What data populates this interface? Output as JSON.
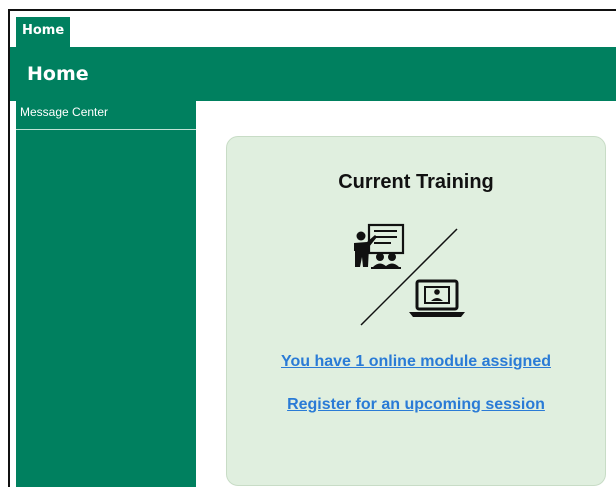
{
  "tabs": [
    {
      "label": "Home"
    }
  ],
  "header": {
    "title": "Home"
  },
  "sidebar": {
    "items": [
      {
        "label": "Message Center"
      }
    ]
  },
  "card": {
    "title": "Current Training",
    "links": [
      {
        "label": "You have 1 online module assigned"
      },
      {
        "label": "Register for an upcoming session"
      }
    ],
    "icons": [
      "classroom-teacher-icon",
      "laptop-user-icon"
    ]
  },
  "colors": {
    "primary": "#00805f",
    "card_bg": "#e0efdf",
    "link": "#2a7bd6"
  }
}
